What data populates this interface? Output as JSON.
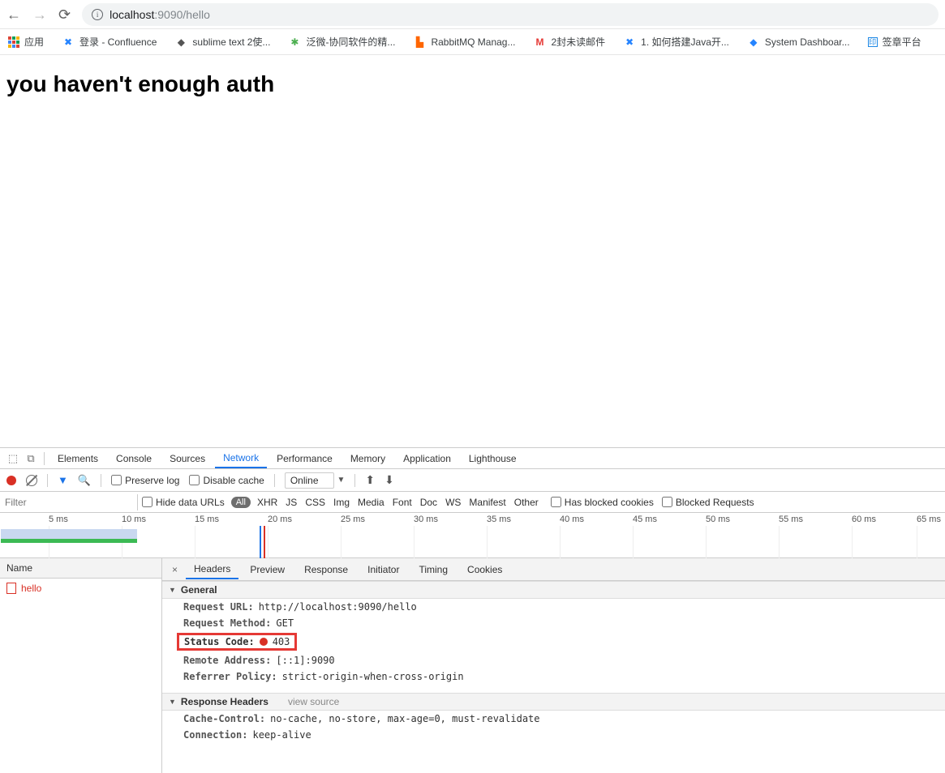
{
  "nav": {
    "url_prefix": "localhost",
    "url_suffix": ":9090/hello"
  },
  "bookmarks": {
    "apps": "应用",
    "items": [
      {
        "label": "登录 - Confluence"
      },
      {
        "label": "sublime text 2使..."
      },
      {
        "label": "泛微-协同软件的精..."
      },
      {
        "label": "RabbitMQ Manag..."
      },
      {
        "label": "2封未读邮件"
      },
      {
        "label": "1. 如何搭建Java开..."
      },
      {
        "label": "System Dashboar..."
      },
      {
        "label": "签章平台"
      }
    ]
  },
  "page": {
    "heading": "you haven't enough auth"
  },
  "devtools": {
    "tabs": [
      "Elements",
      "Console",
      "Sources",
      "Network",
      "Performance",
      "Memory",
      "Application",
      "Lighthouse"
    ],
    "active_tab": "Network",
    "toolbar": {
      "preserve_log": "Preserve log",
      "disable_cache": "Disable cache",
      "online": "Online"
    },
    "filterbar": {
      "placeholder": "Filter",
      "hide_data_urls": "Hide data URLs",
      "all": "All",
      "types": [
        "XHR",
        "JS",
        "CSS",
        "Img",
        "Media",
        "Font",
        "Doc",
        "WS",
        "Manifest",
        "Other"
      ],
      "has_blocked_cookies": "Has blocked cookies",
      "blocked_requests": "Blocked Requests"
    },
    "timeline": {
      "ticks": [
        "5 ms",
        "10 ms",
        "15 ms",
        "20 ms",
        "25 ms",
        "30 ms",
        "35 ms",
        "40 ms",
        "45 ms",
        "50 ms",
        "55 ms",
        "60 ms",
        "65 ms"
      ]
    },
    "requests": {
      "header": "Name",
      "items": [
        {
          "name": "hello"
        }
      ]
    },
    "detail": {
      "tabs": [
        "Headers",
        "Preview",
        "Response",
        "Initiator",
        "Timing",
        "Cookies"
      ],
      "active": "Headers",
      "general_label": "General",
      "general": {
        "request_url": {
          "k": "Request URL:",
          "v": "http://localhost:9090/hello"
        },
        "request_method": {
          "k": "Request Method:",
          "v": "GET"
        },
        "status_code": {
          "k": "Status Code:",
          "v": "403"
        },
        "remote_address": {
          "k": "Remote Address:",
          "v": "[::1]:9090"
        },
        "referrer_policy": {
          "k": "Referrer Policy:",
          "v": "strict-origin-when-cross-origin"
        }
      },
      "resp_label": "Response Headers",
      "view_source": "view source",
      "resp": {
        "cache_control": {
          "k": "Cache-Control:",
          "v": "no-cache, no-store, max-age=0, must-revalidate"
        },
        "connection": {
          "k": "Connection:",
          "v": "keep-alive"
        }
      }
    }
  }
}
